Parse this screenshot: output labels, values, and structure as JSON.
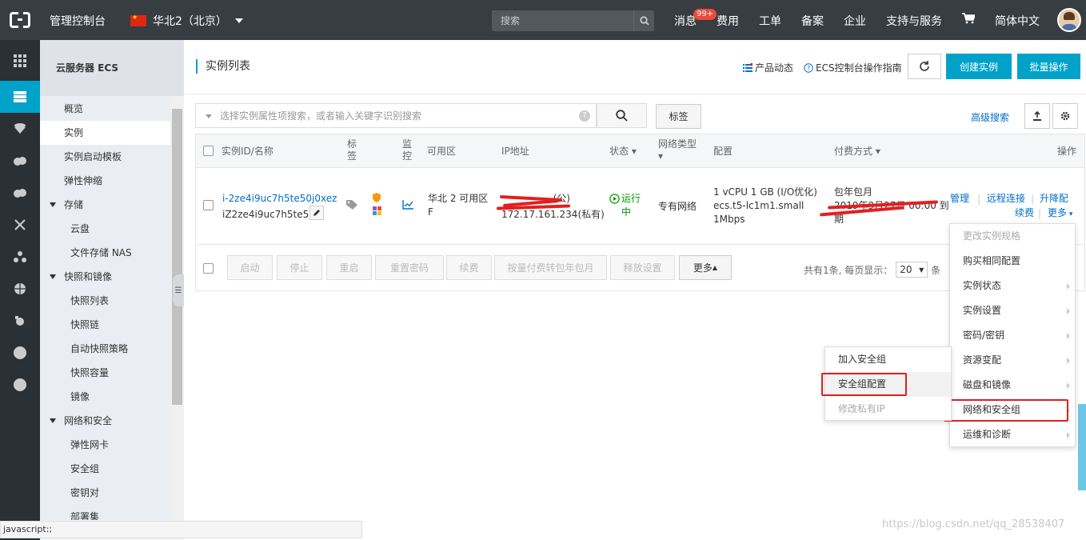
{
  "topbar": {
    "console": "管理控制台",
    "region": "华北2（北京）",
    "search_placeholder": "搜索",
    "messages": "消息",
    "messages_badge": "99+",
    "fees": "费用",
    "tickets": "工单",
    "filing": "备案",
    "enterprise": "企业",
    "support": "支持与服务",
    "language": "简体中文"
  },
  "sidemenu": {
    "title": "云服务器 ECS",
    "items": [
      "概览",
      "实例",
      "实例启动模板",
      "弹性伸缩"
    ],
    "storage": "存储",
    "storage_items": [
      "云盘",
      "文件存储 NAS"
    ],
    "snapshots": "快照和镜像",
    "snapshot_items": [
      "快照列表",
      "快照链",
      "自动快照策略",
      "快照容量",
      "镜像"
    ],
    "network": "网络和安全",
    "network_items": [
      "弹性网卡",
      "安全组",
      "密钥对",
      "部署集"
    ]
  },
  "header": {
    "title": "实例列表",
    "product_news": "产品动态",
    "guide": "ECS控制台操作指南",
    "create": "创建实例",
    "batch": "批量操作"
  },
  "filter": {
    "placeholder": "选择实例属性项搜索，或者输入关键字识别搜索",
    "tag_button": "标签",
    "advanced": "高级搜索"
  },
  "table": {
    "headers": {
      "id": "实例ID/名称",
      "tag": "标签",
      "monitor": "监控",
      "zone": "可用区",
      "ip": "IP地址",
      "status": "状态",
      "net_type": "网络类型",
      "config": "配置",
      "billing": "付费方式",
      "ops": "操作"
    },
    "row": {
      "id": "i-2ze4i9uc7h5te50j0xez",
      "name": "iZ2ze4i9uc7h5te5...",
      "zone": "华北 2 可用区 F",
      "ip_public_suffix": "(公)",
      "ip_private": "172.17.161.234",
      "ip_private_suffix": "(私有)",
      "status": "运行中",
      "net_type": "专有网络",
      "config_line1": "1 vCPU 1 GB (I/O优化)",
      "config_line2": "ecs.t5-lc1m1.small",
      "config_line3": "1Mbps",
      "billing_line1": "包年包月",
      "billing_line2": "2019年9月27日 00:00 到",
      "billing_line3": "期",
      "op_manage": "管理",
      "op_remote": "远程连接",
      "op_upgrade": "升降配",
      "op_renew": "续费",
      "op_more": "更多"
    }
  },
  "footer": {
    "buttons": [
      "启动",
      "停止",
      "重启",
      "重置密码",
      "续费",
      "按量付费转包年包月",
      "释放设置"
    ],
    "more": "更多",
    "total": "共有1条, 每页显示：",
    "page_size": "20",
    "unit": "条"
  },
  "more_menu": {
    "items": [
      "更改实例规格",
      "购买相同配置",
      "实例状态",
      "实例设置",
      "密码/密钥",
      "资源变配",
      "磁盘和镜像",
      "网络和安全组",
      "运维和诊断"
    ]
  },
  "sub_menu": {
    "items": [
      "加入安全组",
      "安全组配置",
      "修改私有IP"
    ]
  },
  "statusbar": "javascript:;",
  "watermark": "https://blog.csdn.net/qq_28538407",
  "colors": {
    "accent": "#00a2ca",
    "topbar": "#373d41",
    "link": "#0070cc",
    "running": "#009900",
    "highlight_box": "#e02020"
  }
}
